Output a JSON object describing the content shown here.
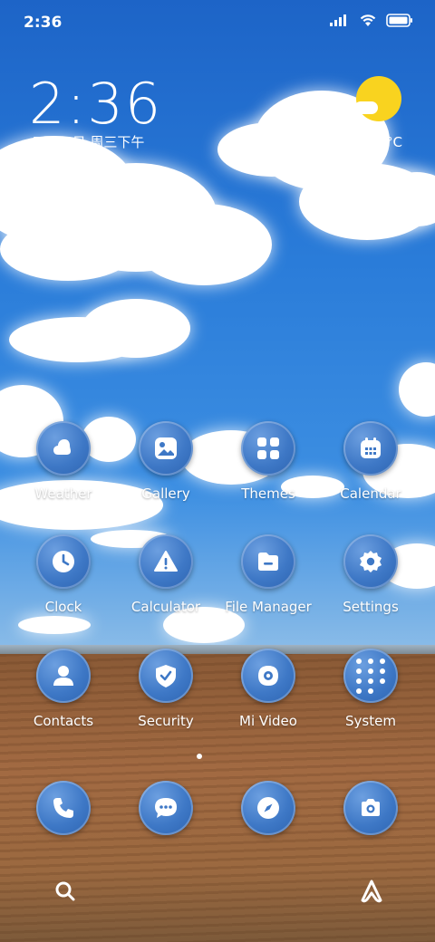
{
  "status_bar": {
    "time": "2:36",
    "icons": [
      "signal-icon",
      "wifi-icon",
      "battery-icon"
    ]
  },
  "widget": {
    "time": "2:36",
    "date": "7月24日 周三下午",
    "weather": "晴 26°C",
    "weather_icon": "sunny-icon"
  },
  "apps": [
    {
      "label": "Weather",
      "icon": "weather-icon"
    },
    {
      "label": "Gallery",
      "icon": "gallery-icon"
    },
    {
      "label": "Themes",
      "icon": "themes-icon"
    },
    {
      "label": "Calendar",
      "icon": "calendar-icon"
    },
    {
      "label": "Clock",
      "icon": "clock-icon"
    },
    {
      "label": "Calculator",
      "icon": "calculator-icon"
    },
    {
      "label": "File Manager",
      "icon": "file-manager-icon"
    },
    {
      "label": "Settings",
      "icon": "settings-icon"
    },
    {
      "label": "Contacts",
      "icon": "contacts-icon"
    },
    {
      "label": "Security",
      "icon": "security-icon"
    },
    {
      "label": "Mi Video",
      "icon": "video-icon"
    },
    {
      "label": "System",
      "icon": "folder-icon"
    }
  ],
  "dock": [
    {
      "icon": "phone-icon"
    },
    {
      "icon": "messages-icon"
    },
    {
      "icon": "browser-icon"
    },
    {
      "icon": "camera-icon"
    }
  ],
  "bottom_bar": {
    "left_icon": "search-icon",
    "right_icon": "assistant-icon"
  },
  "colors": {
    "icon_bg": "#3e78c6",
    "sun": "#f9d31f"
  }
}
